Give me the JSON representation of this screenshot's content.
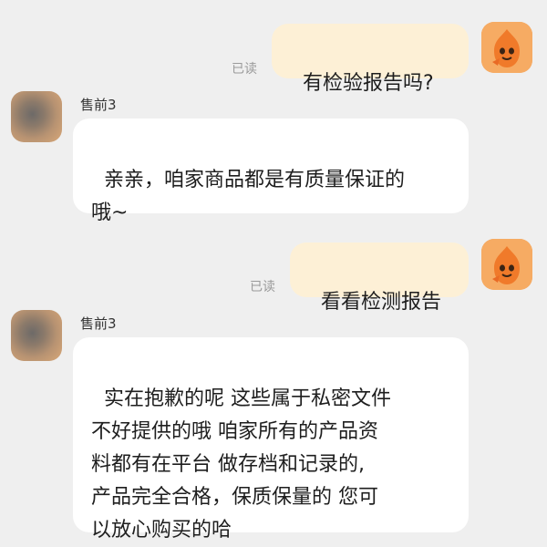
{
  "messages": [
    {
      "side": "out",
      "text": "有检验报告吗?",
      "status": "已读"
    },
    {
      "side": "in",
      "sender": "售前3",
      "text": "亲亲，咱家商品都是有质量保证的\n哦~"
    },
    {
      "side": "out",
      "text": "看看检测报告",
      "status": "已读"
    },
    {
      "side": "in",
      "sender": "售前3",
      "text": "实在抱歉的呢 这些属于私密文件\n不好提供的哦 咱家所有的产品资\n料都有在平台 做存档和记录的,\n产品完全合格，保质保量的 您可\n以放心购买的哈"
    }
  ],
  "colors": {
    "background": "#efefef",
    "outgoing_bubble": "#fdf0d6",
    "incoming_bubble": "#ffffff",
    "user_avatar": "#f3a45c"
  },
  "icons": {
    "seller_avatar": "blurred-photo-avatar",
    "user_avatar": "orange-mascot-icon"
  }
}
